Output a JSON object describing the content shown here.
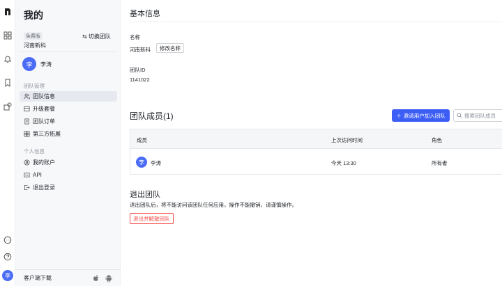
{
  "rail": {
    "avatar_initial": "李",
    "icons": [
      "app-logo-icon",
      "grid-icon",
      "bell-icon",
      "bookmark-icon",
      "extension-icon",
      "chat-icon",
      "help-icon"
    ]
  },
  "sidebar": {
    "title": "我的",
    "plan_badge": "免费版",
    "switch_team": "切换团队",
    "team_name": "河南新科",
    "user": {
      "initial": "李",
      "name": "李涛"
    },
    "section_team": "团队管理",
    "team_items": [
      {
        "label": "团队信息",
        "icon": "team-icon",
        "active": true
      },
      {
        "label": "升级套餐",
        "icon": "upgrade-icon",
        "active": false
      },
      {
        "label": "团队订单",
        "icon": "order-icon",
        "active": false
      },
      {
        "label": "第三方拓展",
        "icon": "extension-icon",
        "active": false
      }
    ],
    "section_personal": "个人信息",
    "personal_items": [
      {
        "label": "我的账户",
        "icon": "account-icon"
      },
      {
        "label": "API",
        "icon": "api-icon"
      },
      {
        "label": "退出登录",
        "icon": "logout-icon"
      }
    ],
    "download_label": "客户端下载"
  },
  "main": {
    "basic_title": "基本信息",
    "name_label": "名称",
    "name_value": "河南新科",
    "rename_button": "修改名称",
    "id_label": "团队ID",
    "id_value": "1141022",
    "members_title": "团队成员(1)",
    "invite_button": "邀请用户加入团队",
    "search_placeholder": "搜索团队成员",
    "table": {
      "headers": [
        "成员",
        "上次访问时间",
        "角色"
      ],
      "rows": [
        {
          "initial": "李",
          "name": "李涛",
          "last_visit": "今天 13:30",
          "role": "所有者"
        }
      ]
    },
    "exit_title": "退出团队",
    "exit_desc": "退出团队后，将不能访问该团队任何应用，操作不能撤销，请谨慎操作。",
    "exit_button": "退出并解散团队",
    "accent_color": "#3c5ef6",
    "danger_color": "#f54a45"
  }
}
